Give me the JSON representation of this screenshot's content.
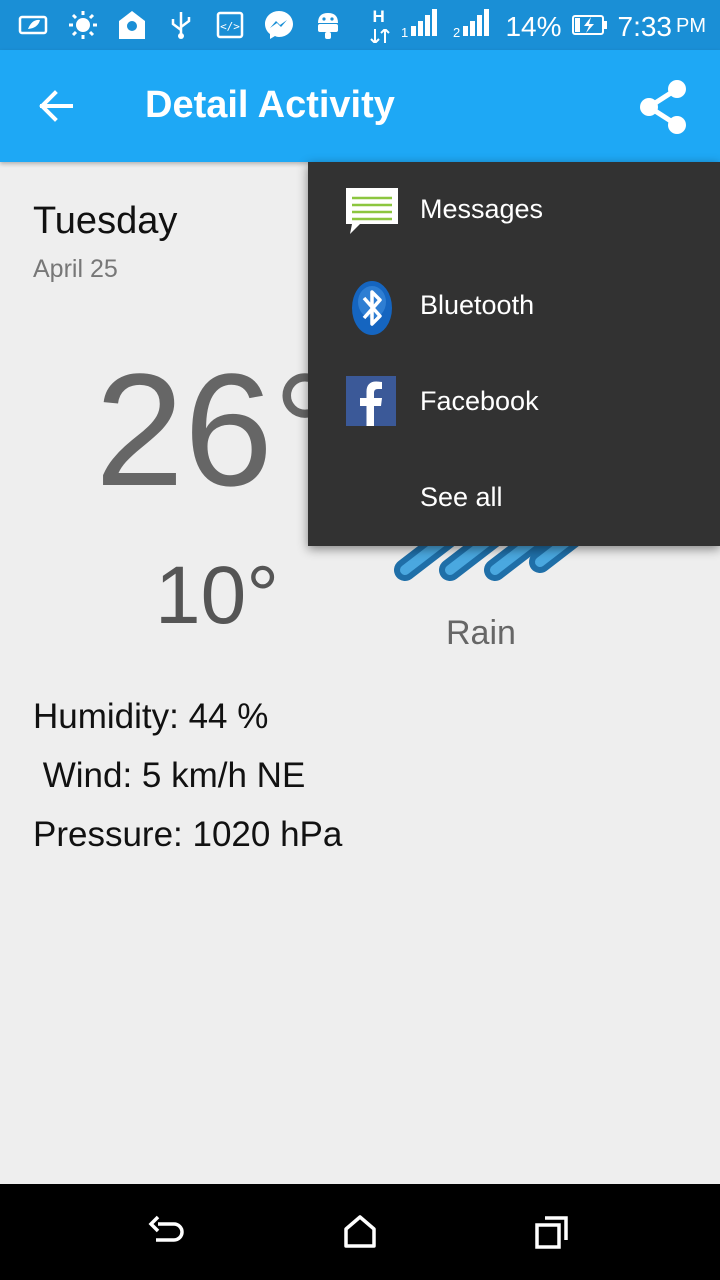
{
  "status_bar": {
    "icons_left": [
      "battery-saver-icon",
      "brightness-icon",
      "location-icon",
      "usb-icon",
      "code-icon",
      "messenger-icon",
      "android-icon"
    ],
    "network": "H",
    "battery_percent": "14%",
    "time": "7:33",
    "ampm": "PM"
  },
  "app_bar": {
    "title": "Detail Activity",
    "back_icon": "back-arrow-icon",
    "share_icon": "share-icon",
    "color": "#1ea8f5"
  },
  "forecast": {
    "day": "Tuesday",
    "date": "April 25",
    "high": "26°",
    "low": "10°",
    "condition": "Rain",
    "humidity": "Humidity: 44 %",
    "wind": " Wind: 5 km/h NE",
    "pressure": "Pressure: 1020 hPa"
  },
  "share_menu": {
    "items": [
      {
        "label": "Messages",
        "icon": "messages-icon"
      },
      {
        "label": "Bluetooth",
        "icon": "bluetooth-icon"
      },
      {
        "label": "Facebook",
        "icon": "facebook-icon"
      },
      {
        "label": "See all",
        "icon": ""
      }
    ]
  },
  "nav_bar": {
    "buttons": [
      "back-nav-icon",
      "home-nav-icon",
      "recents-nav-icon"
    ]
  }
}
